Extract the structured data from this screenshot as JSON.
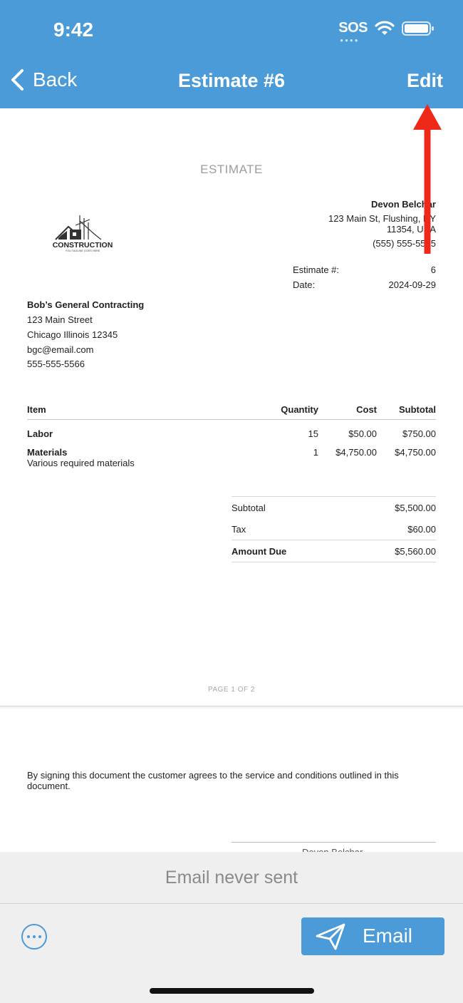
{
  "status_bar": {
    "time": "9:42",
    "sos": "SOS",
    "icons": [
      "wifi-icon",
      "battery-icon"
    ]
  },
  "nav": {
    "back_label": "Back",
    "title": "Estimate #6",
    "edit_label": "Edit",
    "icons": {
      "back": "chevron-left-icon"
    }
  },
  "document": {
    "title": "ESTIMATE",
    "logo": {
      "text": "CONSTRUCTION",
      "tagline": "YOU TAGLINE GOES HERE"
    },
    "client": {
      "name": "Devon Belchar",
      "address_line1": "123 Main St, Flushing, NY",
      "address_line2": "11354, USA",
      "phone": "(555) 555-5555"
    },
    "meta": {
      "estimate_label": "Estimate #:",
      "estimate_value": "6",
      "date_label": "Date:",
      "date_value": "2024-09-29"
    },
    "business": {
      "name": "Bob’s General Contracting",
      "street": "123 Main Street",
      "city": "Chicago Illinois 12345",
      "email": "bgc@email.com",
      "phone": "555-555-5566"
    },
    "table": {
      "headers": [
        "Item",
        "Quantity",
        "Cost",
        "Subtotal"
      ],
      "rows": [
        {
          "item": "Labor",
          "description": "",
          "quantity": "15",
          "cost": "$50.00",
          "subtotal": "$750.00"
        },
        {
          "item": "Materials",
          "description": "Various required materials",
          "quantity": "1",
          "cost": "$4,750.00",
          "subtotal": "$4,750.00"
        }
      ]
    },
    "totals": {
      "subtotal_label": "Subtotal",
      "subtotal_value": "$5,500.00",
      "tax_label": "Tax",
      "tax_value": "$60.00",
      "amount_due_label": "Amount Due",
      "amount_due_value": "$5,560.00"
    },
    "page_indicator": "PAGE 1 OF 2",
    "terms": "By signing this document the customer agrees to the service and conditions outlined in this document.",
    "signature_name": "Devon Belchar"
  },
  "footer": {
    "email_status": "Email never sent",
    "email_button_label": "Email",
    "icons": {
      "more": "more-icon",
      "send": "paper-plane-icon"
    }
  },
  "colors": {
    "brand": "#4a9bd8",
    "annotation_arrow": "#f0281a"
  }
}
